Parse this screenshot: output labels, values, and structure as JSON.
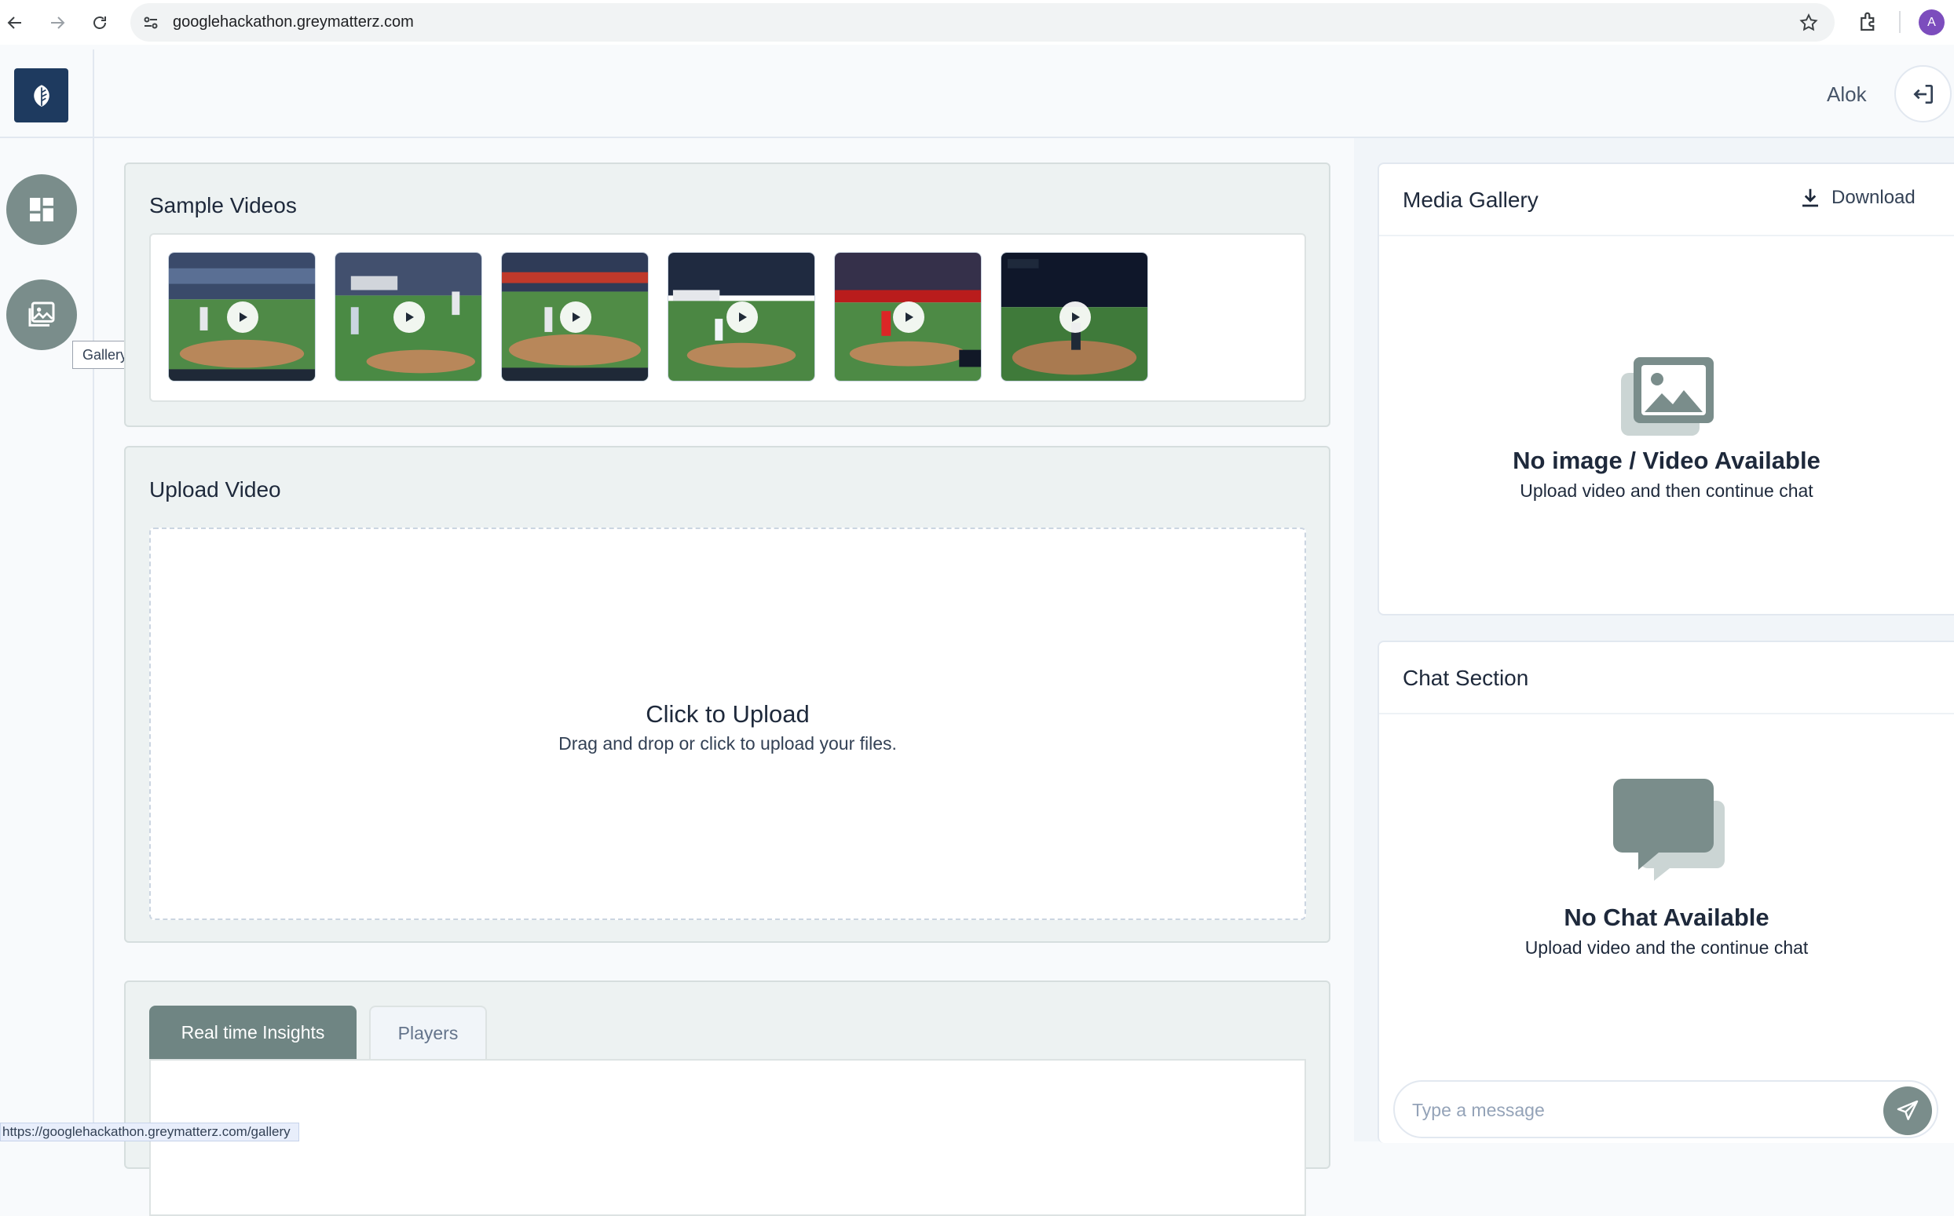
{
  "browser": {
    "url": "googlehackathon.greymatterz.com",
    "profile_initial": "A",
    "status_url": "https://googlehackathon.greymatterz.com/gallery"
  },
  "header": {
    "user_name": "Alok"
  },
  "sidebar": {
    "items": [
      {
        "name": "dashboard",
        "icon": "dashboard-icon"
      },
      {
        "name": "gallery",
        "icon": "gallery-icon"
      }
    ],
    "tooltip": "Gallery"
  },
  "sample_videos": {
    "title": "Sample Videos",
    "count": 6
  },
  "upload": {
    "title": "Upload Video",
    "cta": "Click to Upload",
    "hint": "Drag and drop or click to upload your files."
  },
  "tabs": [
    {
      "label": "Real time Insights",
      "active": true
    },
    {
      "label": "Players",
      "active": false
    }
  ],
  "media_gallery": {
    "title": "Media Gallery",
    "download_label": "Download",
    "empty_title": "No image / Video Available",
    "empty_sub": "Upload video and then continue chat"
  },
  "chat": {
    "title": "Chat Section",
    "empty_title": "No Chat Available",
    "empty_sub": "Upload video and the continue chat",
    "placeholder": "Type a message"
  },
  "colors": {
    "accent": "#7a8d8b",
    "logo_bg": "#1e3a5f",
    "panel_bg": "#edf2f2"
  }
}
